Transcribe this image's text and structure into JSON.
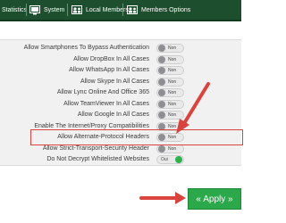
{
  "nav": {
    "items": [
      {
        "label": "Statistics",
        "icon": "statistics-icon"
      },
      {
        "label": "System",
        "icon": "monitor-icon"
      },
      {
        "label": "Local Members",
        "icon": "local-members-icon"
      },
      {
        "label": "Members Options",
        "icon": "members-options-icon"
      }
    ]
  },
  "settings": [
    {
      "label": "Allow Smartphones To Bypass Authentication",
      "state": "Non"
    },
    {
      "label": "Allow DropBox In All Cases",
      "state": "Non"
    },
    {
      "label": "Allow WhatsApp In All Cases",
      "state": "Non"
    },
    {
      "label": "Allow Skype In All Cases",
      "state": "Non"
    },
    {
      "label": "Allow Lync Online And Office 365",
      "state": "Non"
    },
    {
      "label": "Allow TeamViewer In All Cases",
      "state": "Non"
    },
    {
      "label": "Allow Google In All Cases",
      "state": "Non"
    },
    {
      "label": "Enable The Internet/Proxy Compatibilities",
      "state": "Non"
    },
    {
      "label": "Allow Alternate-Protocol Headers",
      "state": "Non"
    },
    {
      "label": "Allow Strict-Transport-Security Header",
      "state": "Non"
    },
    {
      "label": "Do Not Decrypt Whitelisted Websites",
      "state": "Oui"
    }
  ],
  "apply_label": "« Apply »",
  "colors": {
    "nav_background": "#1d4e2d",
    "toggle_off_knob": "#8d8f93",
    "toggle_on_knob": "#2fb24c",
    "apply_button": "#2aa84a",
    "annotation": "#d9453e"
  }
}
